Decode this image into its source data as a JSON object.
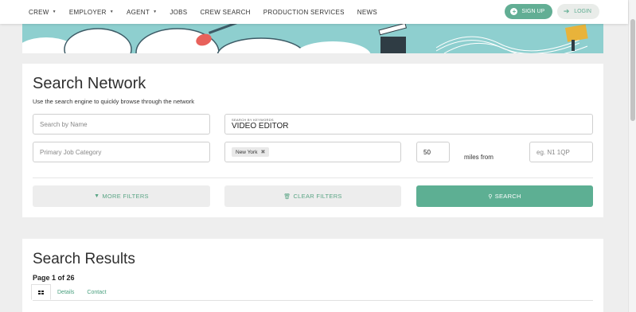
{
  "nav": {
    "items": [
      {
        "label": "CREW",
        "dropdown": true
      },
      {
        "label": "EMPLOYER",
        "dropdown": true
      },
      {
        "label": "AGENT",
        "dropdown": true
      },
      {
        "label": "JOBS",
        "dropdown": false
      },
      {
        "label": "CREW SEARCH",
        "dropdown": false
      },
      {
        "label": "PRODUCTION SERVICES",
        "dropdown": false
      },
      {
        "label": "NEWS",
        "dropdown": false
      }
    ],
    "signup_label": "SIGN UP",
    "login_label": "LOGIN"
  },
  "search": {
    "title": "Search Network",
    "subtitle": "Use the search engine to quickly browse through the network",
    "name_placeholder": "Search by Name",
    "keywords_mini_label": "SEARCH BY KEYWORDS",
    "keywords_value": "VIDEO EDITOR",
    "job_category_placeholder": "Primary Job Category",
    "location_tag": "New York",
    "miles_value": "50",
    "miles_label": "miles from",
    "postcode_placeholder": "eg. N1 1QP",
    "more_filters_label": "MORE FILTERS",
    "clear_filters_label": "CLEAR FILTERS",
    "search_label": "SEARCH"
  },
  "results": {
    "title": "Search Results",
    "page_info": "Page 1 of 26",
    "tabs": [
      "Details",
      "Contact"
    ]
  },
  "colors": {
    "accent": "#5daf93",
    "banner_bg": "#8ecfcf",
    "page_bg": "#eeeeee"
  }
}
